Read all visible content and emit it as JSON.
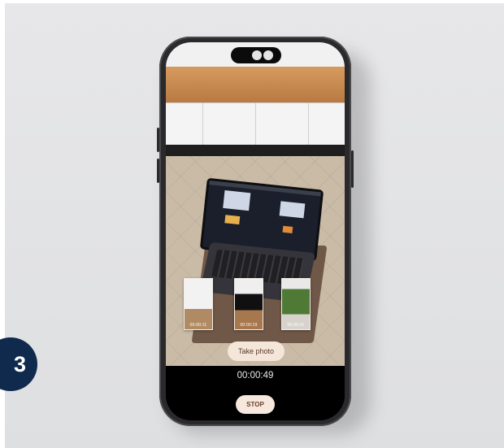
{
  "step": {
    "number": "3"
  },
  "camera": {
    "take_photo_label": "Take photo",
    "timer": "00:00:49",
    "stop_label": "STOP"
  },
  "ar_thumbnails": [
    {
      "label": "00:00:11"
    },
    {
      "label": "00:00:19"
    },
    {
      "label": "00:00:41"
    }
  ],
  "colors": {
    "step_badge": "#0f2a4d",
    "button_fill": "#f5e6da",
    "phone_body": "#2a2a2c"
  }
}
